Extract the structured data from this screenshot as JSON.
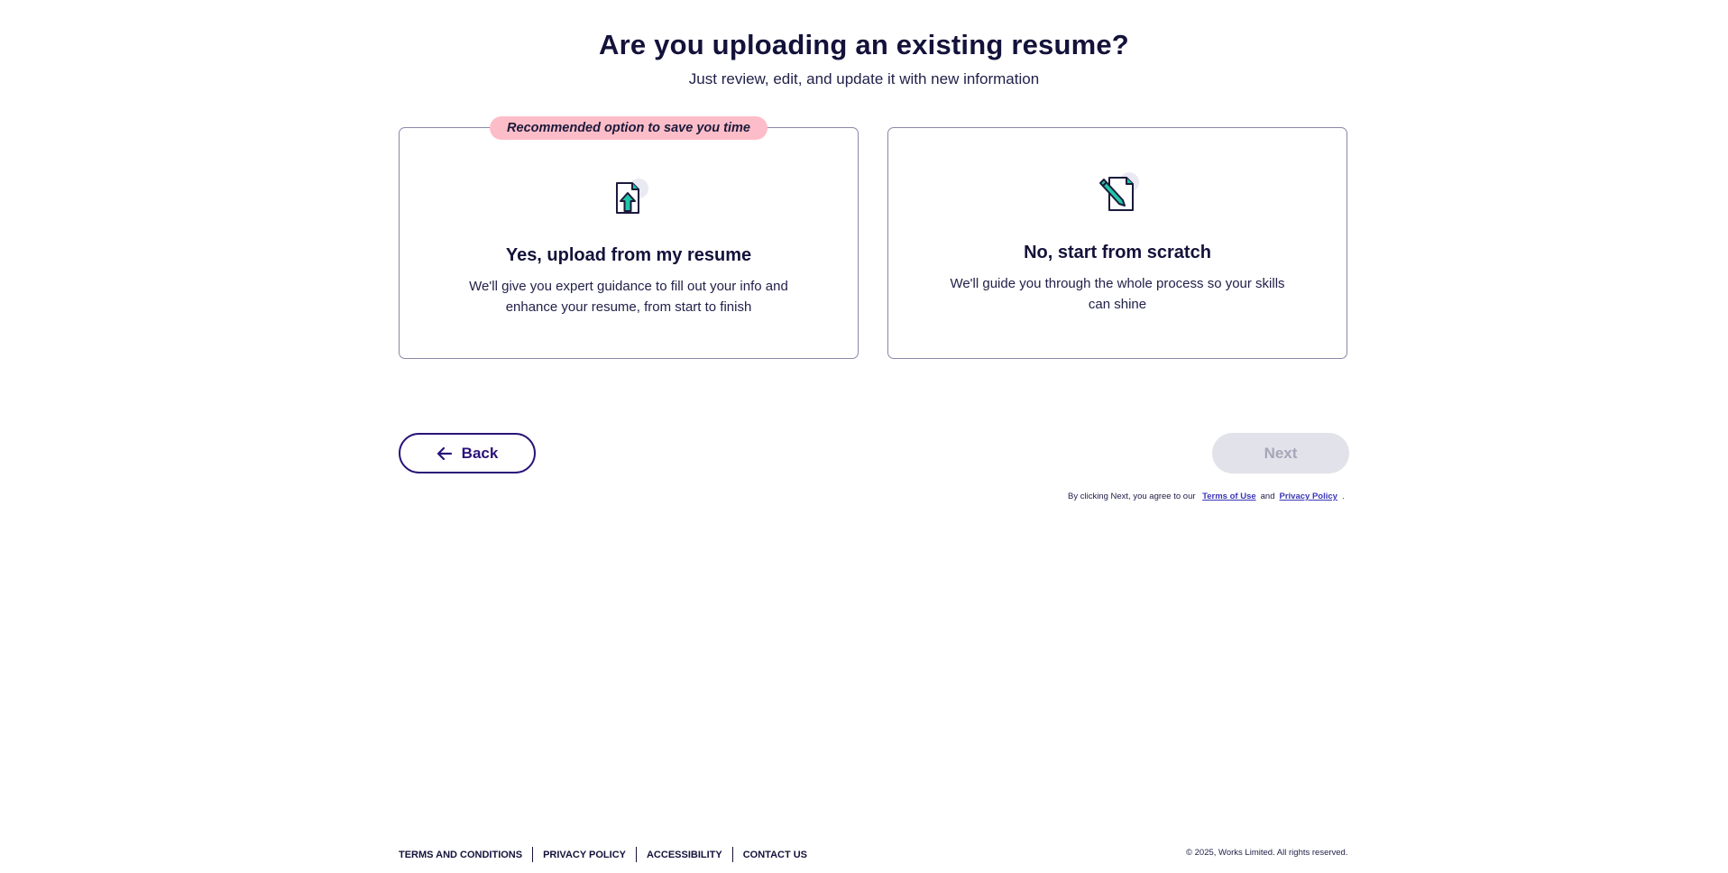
{
  "header": {
    "title": "Are you uploading an existing resume?",
    "subtitle": "Just review, edit, and update it with new information"
  },
  "options": [
    {
      "badge": "Recommended option to save you time",
      "title": "Yes, upload from my resume",
      "description": "We'll give you expert guidance to fill out your info and enhance your resume, from start to finish",
      "icon": "upload-document-icon"
    },
    {
      "title": "No, start from scratch",
      "description": "We'll guide you through the whole process so your skills can shine",
      "icon": "pen-document-icon"
    }
  ],
  "nav": {
    "back_label": "Back",
    "next_label": "Next"
  },
  "agreement": {
    "prefix": "By clicking Next, you agree to our",
    "terms_label": "Terms of Use",
    "and": "and",
    "privacy_label": "Privacy Policy",
    "suffix": "."
  },
  "footer": {
    "links": [
      "TERMS AND CONDITIONS",
      "PRIVACY POLICY",
      "ACCESSIBILITY",
      "CONTACT US"
    ],
    "copyright": "© 2025, Works Limited. All rights reserved."
  },
  "colors": {
    "primary": "#2a1378",
    "badge": "#fdbdc8",
    "icon_accent": "#1fc7a6",
    "disabled_bg": "#e2e2ea"
  }
}
